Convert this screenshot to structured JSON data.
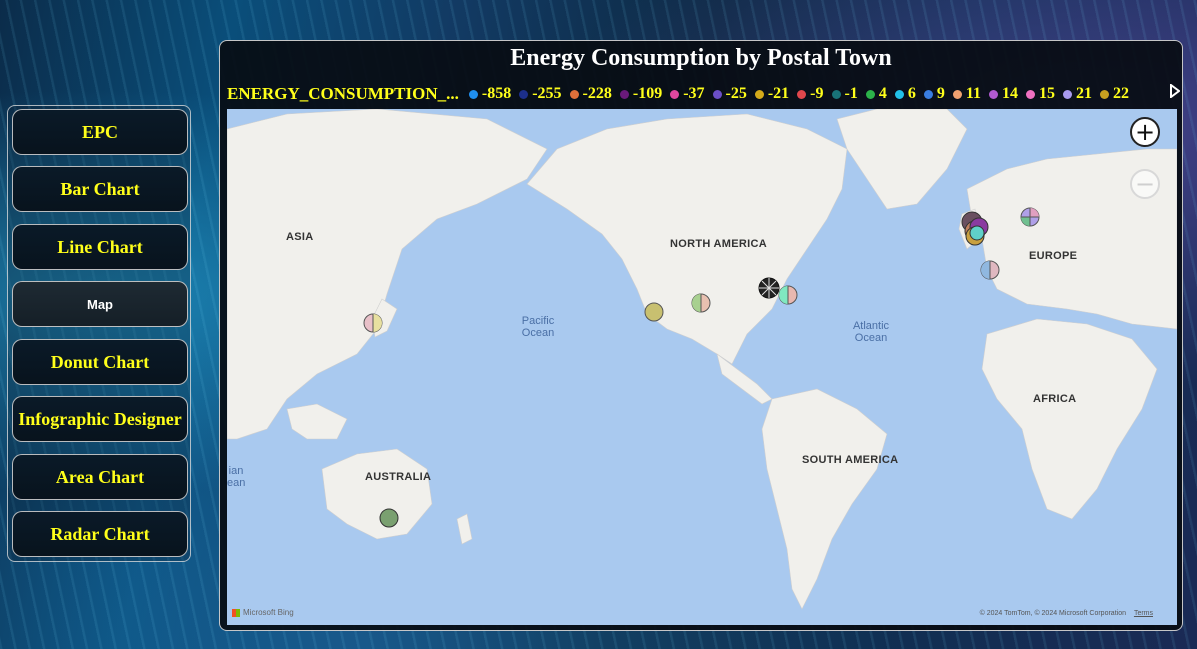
{
  "sidebar": {
    "items": [
      {
        "label": "EPC",
        "active": false
      },
      {
        "label": "Bar Chart",
        "active": false
      },
      {
        "label": "Line Chart",
        "active": false
      },
      {
        "label": "Map",
        "active": true
      },
      {
        "label": "Donut Chart",
        "active": false
      },
      {
        "label": "Infographic Designer",
        "active": false
      },
      {
        "label": "Area Chart",
        "active": false
      },
      {
        "label": "Radar Chart",
        "active": false
      }
    ]
  },
  "panel": {
    "title": "Energy Consumption by Postal Town",
    "legend_title": "ENERGY_CONSUMPTION_...",
    "legend_next_icon": "chevron-right-icon",
    "legend": [
      {
        "label": "-858",
        "color": "#1f8ff0"
      },
      {
        "label": "-255",
        "color": "#1c2f8c"
      },
      {
        "label": "-228",
        "color": "#e0703a"
      },
      {
        "label": "-109",
        "color": "#6a1a7a"
      },
      {
        "label": "-37",
        "color": "#e0479e"
      },
      {
        "label": "-25",
        "color": "#6b4fc7"
      },
      {
        "label": "-21",
        "color": "#d4aa1a"
      },
      {
        "label": "-9",
        "color": "#e0474c"
      },
      {
        "label": "-1",
        "color": "#197278"
      },
      {
        "label": "4",
        "color": "#2cb34a"
      },
      {
        "label": "6",
        "color": "#22c0e8"
      },
      {
        "label": "9",
        "color": "#3a7de0"
      },
      {
        "label": "11",
        "color": "#f0a070"
      },
      {
        "label": "14",
        "color": "#b05ad0"
      },
      {
        "label": "15",
        "color": "#f070c0"
      },
      {
        "label": "21",
        "color": "#a99af0"
      },
      {
        "label": "22",
        "color": "#c8a020"
      }
    ]
  },
  "map": {
    "continent_labels": {
      "asia": "ASIA",
      "north_america": "NORTH AMERICA",
      "europe": "EUROPE",
      "africa": "AFRICA",
      "south_america": "SOUTH AMERICA",
      "australia": "AUSTRALIA"
    },
    "ocean_labels": {
      "pacific": "Pacific Ocean",
      "atlantic": "Atlantic Ocean",
      "indian_fragment": "ian ean"
    },
    "zoom_in_icon": "+",
    "zoom_out_icon": "−",
    "attribution": "Microsoft Bing",
    "copyright": "© 2024 TomTom, © 2024 Microsoft Corporation",
    "terms": "Terms"
  }
}
